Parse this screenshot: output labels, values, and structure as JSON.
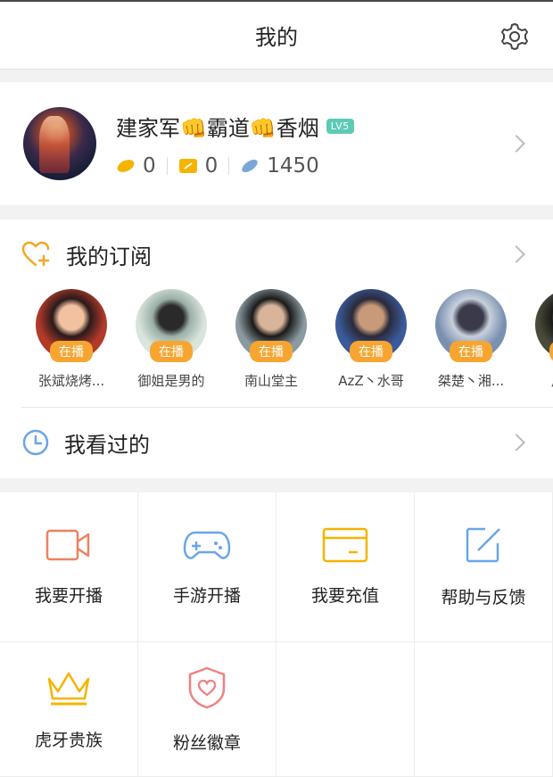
{
  "header": {
    "title": "我的",
    "settings_icon": "gear-icon"
  },
  "profile": {
    "name": "建家军👊霸道👊香烟",
    "level": "LV5",
    "stats": [
      {
        "icon": "gold-bean-icon",
        "value": "0",
        "color": "#f5b400"
      },
      {
        "icon": "coupon-icon",
        "value": "0",
        "color": "#f5b400"
      },
      {
        "icon": "silver-bean-icon",
        "value": "1450",
        "color": "#7aa6d8"
      }
    ]
  },
  "subscriptions": {
    "label": "我的订阅",
    "live_label": "在播",
    "anchors": [
      {
        "name": "张斌烧烤...",
        "colors": [
          "#b23a2a",
          "#f2c2a0",
          "#2a1a1a"
        ]
      },
      {
        "name": "御姐是男的",
        "colors": [
          "#d8e4dc",
          "#2a2a2a",
          "#9bb0a8"
        ]
      },
      {
        "name": "南山堂主",
        "colors": [
          "#8a9aa0",
          "#d8b49a",
          "#1a1a1a"
        ]
      },
      {
        "name": "AzZ丶水哥",
        "colors": [
          "#3a5a9a",
          "#c89a7a",
          "#2a2a3a"
        ]
      },
      {
        "name": "桀楚丶湘...",
        "colors": [
          "#7a90b0",
          "#3a3a4a",
          "#c8d0dc"
        ]
      },
      {
        "name": "户外...",
        "colors": [
          "#4a4a3a",
          "#d8b080",
          "#1a1a1a"
        ]
      }
    ]
  },
  "history": {
    "label": "我看过的"
  },
  "grid": [
    {
      "id": "go-live",
      "label": "我要开播",
      "icon": "video-camera-icon",
      "color": "#f08060"
    },
    {
      "id": "mobile-game-live",
      "label": "手游开播",
      "icon": "gamepad-icon",
      "color": "#6aa6e8"
    },
    {
      "id": "recharge",
      "label": "我要充值",
      "icon": "wallet-icon",
      "color": "#f5b400"
    },
    {
      "id": "feedback",
      "label": "帮助与反馈",
      "icon": "edit-icon",
      "color": "#6aa6e8"
    },
    {
      "id": "nobility",
      "label": "虎牙贵族",
      "icon": "crown-icon",
      "color": "#f5b400"
    },
    {
      "id": "fan-badge",
      "label": "粉丝徽章",
      "icon": "heart-shield-icon",
      "color": "#f08080"
    }
  ]
}
